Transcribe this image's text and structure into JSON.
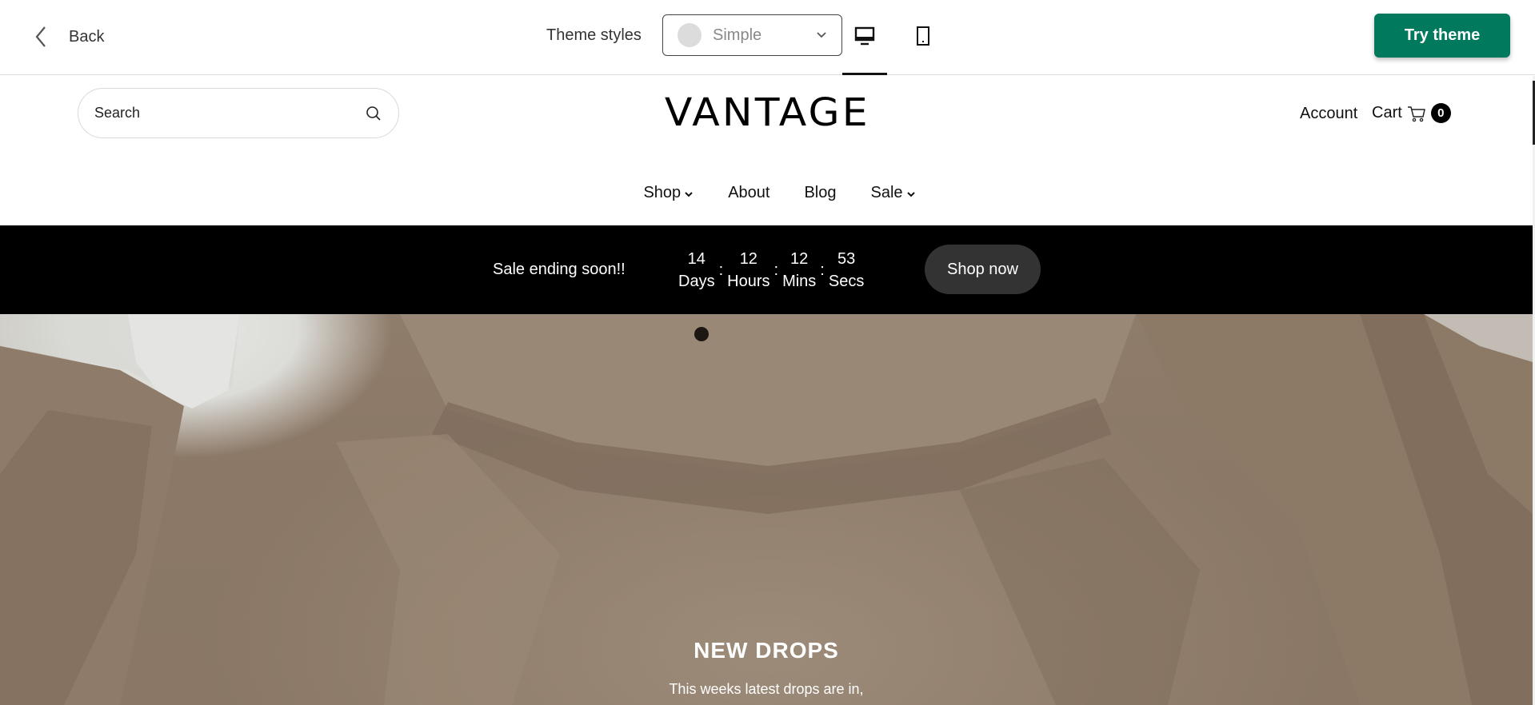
{
  "topbar": {
    "back_label": "Back",
    "theme_styles_label": "Theme styles",
    "theme_select_value": "Simple",
    "try_theme_label": "Try theme",
    "colors": {
      "try_theme": "#00795c"
    }
  },
  "store": {
    "search_placeholder": "Search",
    "logo": "VANTAGE",
    "account_label": "Account",
    "cart_label": "Cart",
    "cart_count": "0",
    "nav": {
      "shop": "Shop",
      "about": "About",
      "blog": "Blog",
      "sale": "Sale"
    },
    "promo": {
      "text": "Sale ending soon!!",
      "countdown": {
        "days_value": "14",
        "days_label": "Days",
        "hours_value": "12",
        "hours_label": "Hours",
        "mins_value": "12",
        "mins_label": "Mins",
        "secs_value": "53",
        "secs_label": "Secs",
        "separator": ":"
      },
      "button_label": "Shop now"
    },
    "hero": {
      "title": "NEW DROPS",
      "subtitle": "This weeks latest drops are in,"
    }
  },
  "icons": [
    "chevron-left-icon",
    "chevron-down-icon",
    "desktop-icon",
    "mobile-icon",
    "search-icon",
    "cart-icon"
  ]
}
